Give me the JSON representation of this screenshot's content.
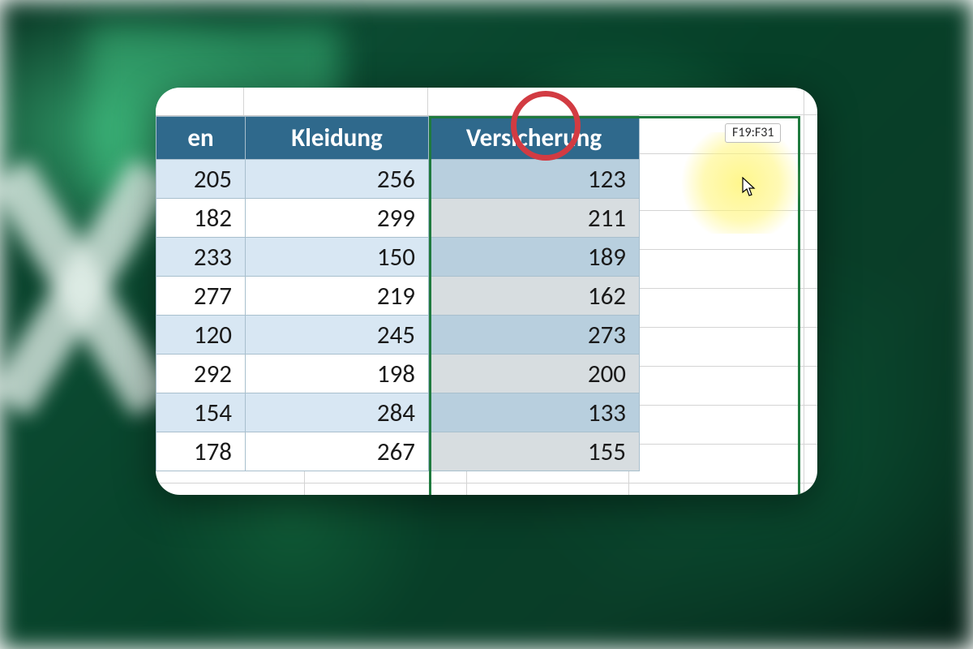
{
  "range_tooltip": "F19:F31",
  "columns": {
    "col_a_header_fragment": "en",
    "col_b_header": "Kleidung",
    "col_c_header": "Versicherung"
  },
  "rows": [
    {
      "a": "205",
      "b": "256",
      "c": "123"
    },
    {
      "a": "182",
      "b": "299",
      "c": "211"
    },
    {
      "a": "233",
      "b": "150",
      "c": "189"
    },
    {
      "a": "277",
      "b": "219",
      "c": "162"
    },
    {
      "a": "120",
      "b": "245",
      "c": "273"
    },
    {
      "a": "292",
      "b": "198",
      "c": "200"
    },
    {
      "a": "154",
      "b": "284",
      "c": "133"
    },
    {
      "a": "178",
      "b": "267",
      "c": "155"
    }
  ],
  "colors": {
    "header_bg": "#2f698c",
    "band_light": "#d8e7f3",
    "selection_border": "#1f7a3e",
    "annotation_red": "#d23b42",
    "highlight_yellow": "#fff578"
  }
}
